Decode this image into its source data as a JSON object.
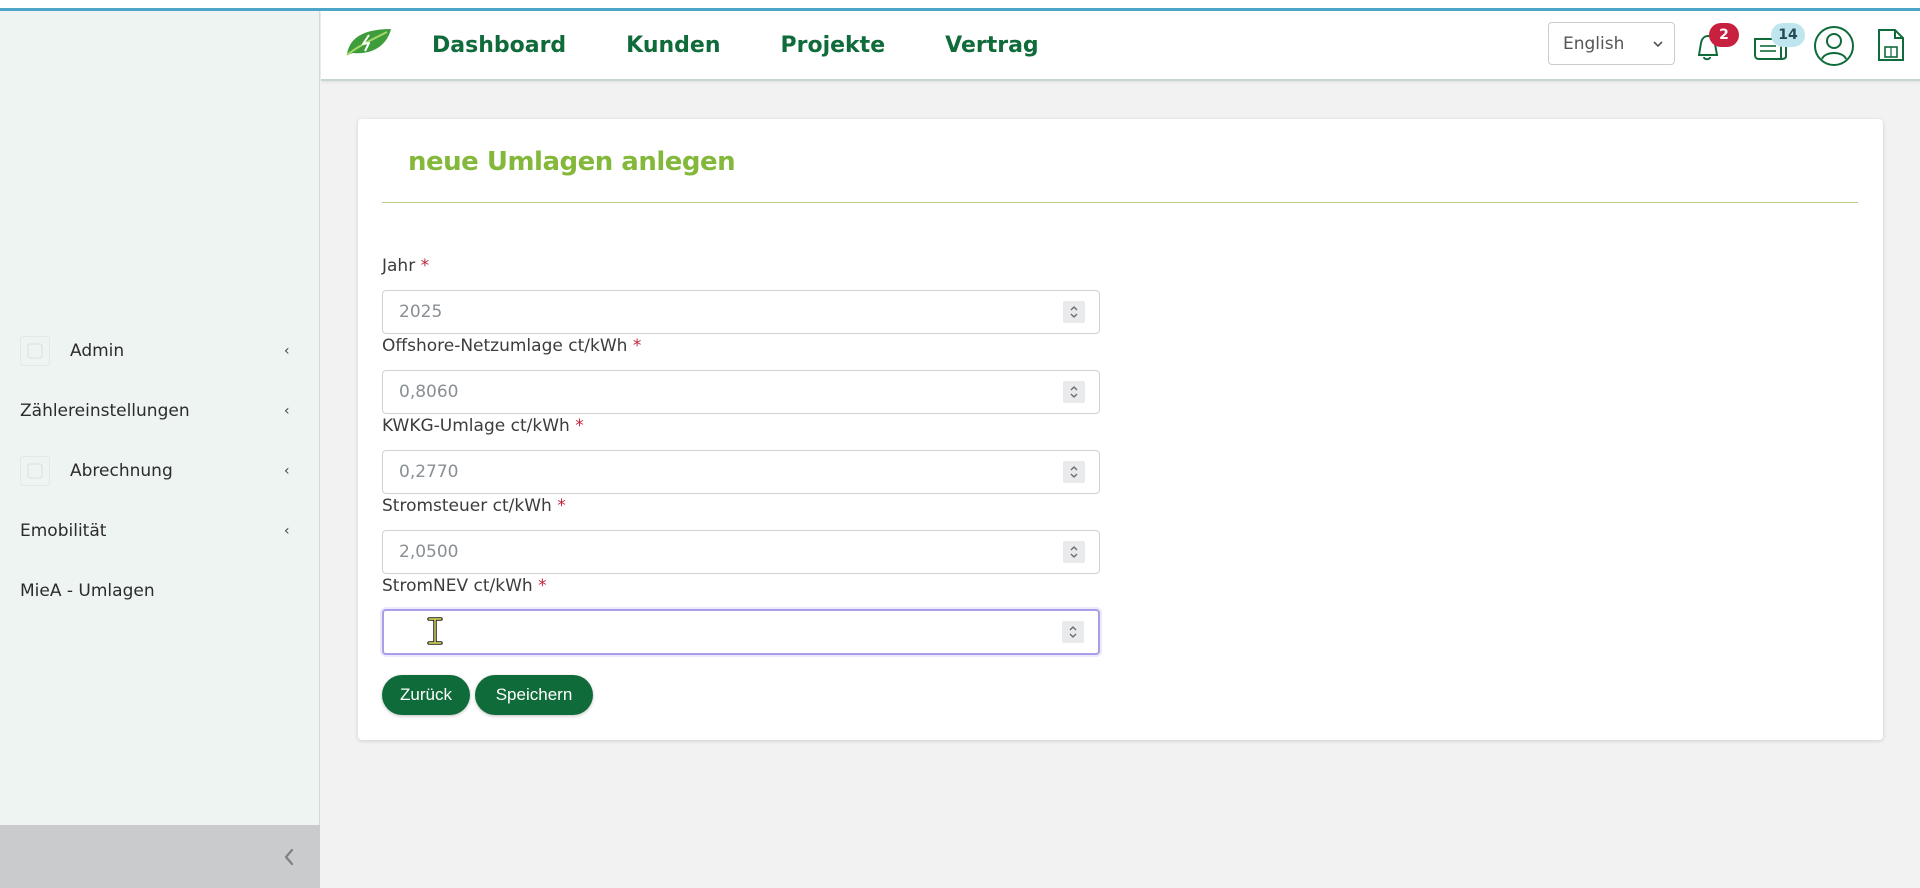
{
  "nav": {
    "items": [
      "Dashboard",
      "Kunden",
      "Projekte",
      "Vertrag"
    ]
  },
  "header": {
    "language": "English",
    "notifications_count": "2",
    "news_count": "14"
  },
  "sidebar": {
    "items": [
      {
        "label": "Admin"
      },
      {
        "label": "Zählereinstellungen"
      },
      {
        "label": "Abrechnung"
      },
      {
        "label": "Emobilität"
      },
      {
        "label": "MieA - Umlagen"
      }
    ]
  },
  "form": {
    "title": "neue Umlagen anlegen",
    "required_marker": "*",
    "fields": [
      {
        "label": "Jahr",
        "value": "2025"
      },
      {
        "label": "Offshore-Netzumlage ct/kWh",
        "value": "0,8060"
      },
      {
        "label": "KWKG-Umlage ct/kWh",
        "value": "0,2770"
      },
      {
        "label": "Stromsteuer ct/kWh",
        "value": "2,0500"
      },
      {
        "label": "StromNEV ct/kWh",
        "value": ""
      }
    ],
    "back_label": "Zurück",
    "save_label": "Speichern"
  },
  "colors": {
    "brand_green": "#0f6b3a",
    "title_green": "#84b83a",
    "required_red": "#c0243b",
    "badge_red": "#c8203f",
    "badge_blue": "#bfe6ee"
  }
}
